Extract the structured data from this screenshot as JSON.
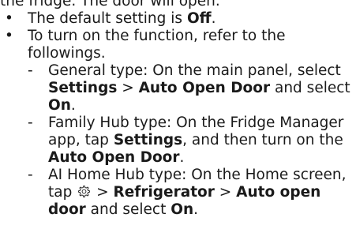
{
  "intro_fragment": "the fridge. The door will open.",
  "bullets": [
    {
      "text_before": "The default setting is ",
      "bold": "Off",
      "text_after": "."
    },
    {
      "text": "To turn on the function, refer to the followings.",
      "subitems": [
        {
          "t1": "General type: On the main panel, select ",
          "b1": "Settings",
          "t2": " > ",
          "b2": "Auto Open Door",
          "t3": " and select ",
          "b3": "On",
          "t4": "."
        },
        {
          "t1": "Family Hub type: On the Fridge Manager app, tap ",
          "b1": "Settings",
          "t2": ", and then turn on the ",
          "b2": "Auto Open Door",
          "t3": "."
        },
        {
          "t1": "AI Home Hub type: On the Home screen, tap ",
          "icon": "gear-icon",
          "t2": " > ",
          "b1": "Refrigerator",
          "t3": " > ",
          "b2": "Auto open door",
          "t4": " and select ",
          "b3": "On",
          "t5": "."
        }
      ]
    }
  ],
  "bullet_glyph": "•",
  "dash_glyph": "-"
}
